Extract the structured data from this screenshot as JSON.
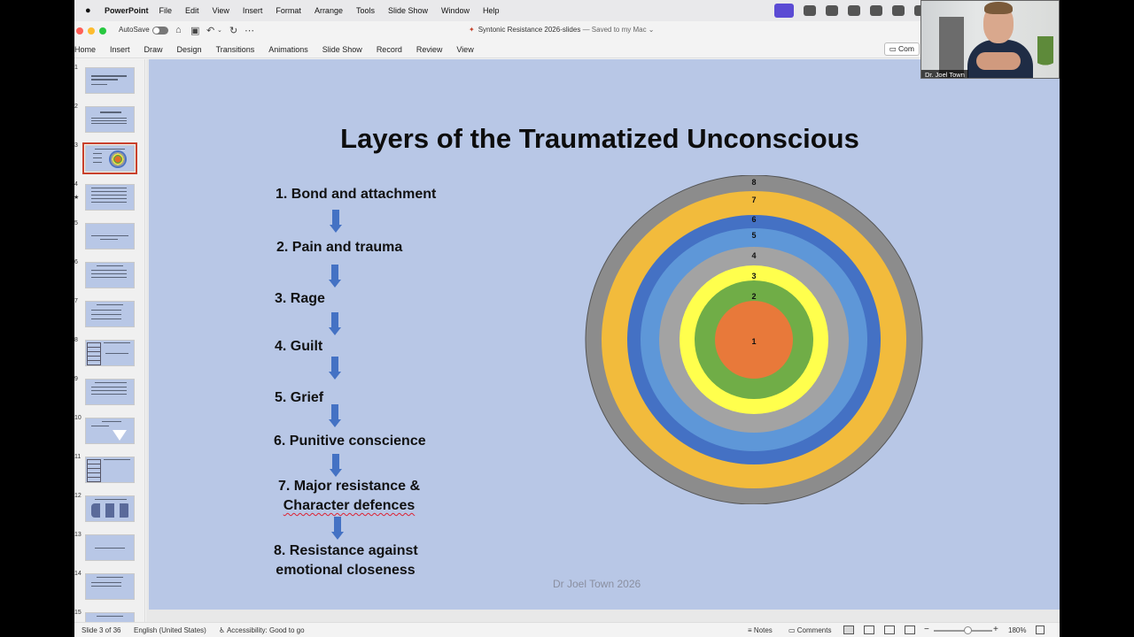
{
  "menubar": {
    "app_name": "PowerPoint",
    "items": [
      "File",
      "Edit",
      "View",
      "Insert",
      "Format",
      "Arrange",
      "Tools",
      "Slide Show",
      "Window",
      "Help"
    ]
  },
  "titlebar": {
    "autosave_label": "AutoSave",
    "autosave_on": false,
    "document_title": "Syntonic Resistance 2026-slides",
    "save_status": "— Saved to my Mac ⌄"
  },
  "ribbon": {
    "tabs": [
      "Home",
      "Insert",
      "Draw",
      "Design",
      "Transitions",
      "Animations",
      "Slide Show",
      "Record",
      "Review",
      "View"
    ],
    "comments_label": "Com"
  },
  "thumbnails": {
    "selected_index": 3,
    "items": [
      {
        "number": "1",
        "starred": false
      },
      {
        "number": "2",
        "starred": false
      },
      {
        "number": "3",
        "starred": false
      },
      {
        "number": "4",
        "starred": true
      },
      {
        "number": "5",
        "starred": false
      },
      {
        "number": "6",
        "starred": false
      },
      {
        "number": "7",
        "starred": false
      },
      {
        "number": "8",
        "starred": false
      },
      {
        "number": "9",
        "starred": false
      },
      {
        "number": "10",
        "starred": false
      },
      {
        "number": "11",
        "starred": false
      },
      {
        "number": "12",
        "starred": false
      },
      {
        "number": "13",
        "starred": false
      },
      {
        "number": "14",
        "starred": false
      },
      {
        "number": "15",
        "starred": false
      }
    ]
  },
  "slide": {
    "title": "Layers of the Traumatized Unconscious",
    "layers": [
      "1. Bond and attachment",
      "2. Pain and trauma",
      "3. Rage",
      "4. Guilt",
      "5. Grief",
      "6. Punitive conscience",
      "7. Major resistance & Character defences",
      "8. Resistance against emotional closeness"
    ],
    "layer_line1": {
      "l7": "7. Major resistance &",
      "l8": "8. Resistance against"
    },
    "layer_line2": {
      "l7": "Character defences",
      "l8": "emotional closeness"
    },
    "footer": "Dr Joel Town 2026",
    "rings": [
      {
        "label": "8",
        "color": "#8c8c8c"
      },
      {
        "label": "7",
        "color": "#f2bb3c"
      },
      {
        "label": "6",
        "color": "#4471c4"
      },
      {
        "label": "5",
        "color": "#5e97d8"
      },
      {
        "label": "4",
        "color": "#a3a3a3"
      },
      {
        "label": "3",
        "color": "#ffff4d"
      },
      {
        "label": "2",
        "color": "#70ad47"
      },
      {
        "label": "1",
        "color": "#e8793a"
      }
    ]
  },
  "statusbar": {
    "slide_indicator": "Slide 3 of 36",
    "language": "English (United States)",
    "accessibility": "Accessibility: Good to go",
    "notes_label": "Notes",
    "comments_label": "Comments",
    "zoom": "180%"
  },
  "webcam": {
    "name_label": "Dr. Joel Town"
  },
  "colors": {
    "slide_background": "#b8c7e6",
    "arrow": "#4472c4",
    "selected_thumb_border": "#c9412c",
    "brand_purple": "#5b4bd4"
  }
}
